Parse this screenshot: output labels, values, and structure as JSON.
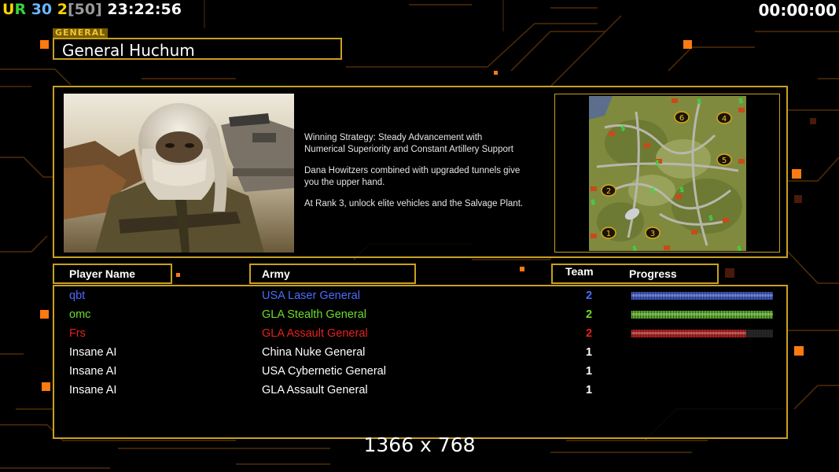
{
  "hud": {
    "left_segments": [
      {
        "text": "U",
        "color": "#ffd400"
      },
      {
        "text": "R",
        "color": "#39d43a"
      },
      {
        "text": " 30",
        "color": "#6ab6ff"
      },
      {
        "text": " 2",
        "color": "#ffd400"
      },
      {
        "text": "[50]",
        "color": "#9a9a9a"
      },
      {
        "text": " 23:22:56",
        "color": "#ffffff"
      }
    ],
    "timer": "00:00:00"
  },
  "general": {
    "tab_label": "GENERAL",
    "name": "General Huchum"
  },
  "strategy": {
    "paragraphs": [
      "Winning Strategy: Steady Advancement with\n Numerical Superiority and Constant Artillery Support",
      "Dana Howitzers combined with upgraded tunnels give\n you the upper hand.",
      "At Rank 3, unlock elite vehicles and the Salvage Plant."
    ]
  },
  "minimap": {
    "start_positions": [
      "1",
      "2",
      "3",
      "4",
      "5",
      "6"
    ],
    "dollar_sign": "$"
  },
  "columns": {
    "player": "Player Name",
    "army": "Army",
    "team": "Team",
    "progress": "Progress"
  },
  "players": [
    {
      "name": "qbt",
      "army": "USA Laser General",
      "team": "2",
      "color": "#4a6cff",
      "progress": 1.0
    },
    {
      "name": "omc",
      "army": "GLA Stealth General",
      "team": "2",
      "color": "#6edc2a",
      "progress": 1.0
    },
    {
      "name": "Frs",
      "army": "GLA Assault General",
      "team": "2",
      "color": "#e8201e",
      "progress": 0.81
    },
    {
      "name": "Insane AI",
      "army": "China Nuke General",
      "team": "1",
      "color": "#ffffff",
      "progress": null
    },
    {
      "name": "Insane AI",
      "army": "USA Cybernetic General",
      "team": "1",
      "color": "#ffffff",
      "progress": null
    },
    {
      "name": "Insane AI",
      "army": "GLA Assault General",
      "team": "1",
      "color": "#ffffff",
      "progress": null
    }
  ],
  "resolution": "1366 x 768",
  "colors": {
    "frame": "#c9a020",
    "grid_lines": "#6b3a0a",
    "accent_squares": "#ff7a10"
  }
}
